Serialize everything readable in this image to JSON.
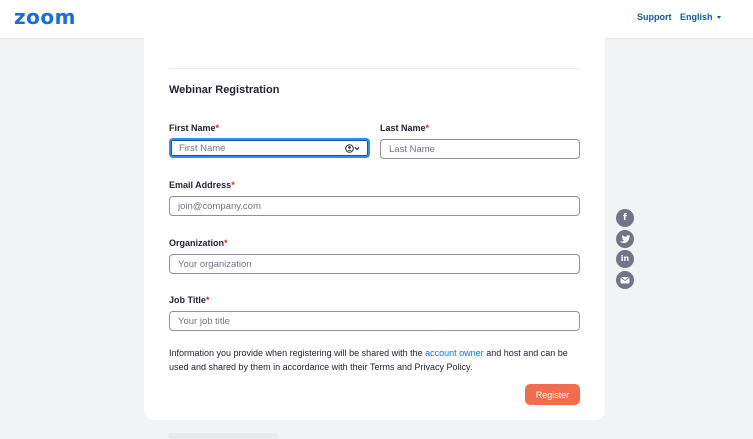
{
  "header": {
    "logo": "zoom",
    "support_label": "Support",
    "language_label": "English"
  },
  "form": {
    "title": "Webinar Registration",
    "first_name": {
      "label": "First Name",
      "required": "*",
      "placeholder": "First Name"
    },
    "last_name": {
      "label": "Last Name",
      "required": "*",
      "placeholder": "Last Name"
    },
    "email": {
      "label": "Email Address",
      "required": "*",
      "placeholder": "join@company.com"
    },
    "organization": {
      "label": "Organization",
      "required": "*",
      "placeholder": "Your organization"
    },
    "job_title": {
      "label": "Job Title",
      "required": "*",
      "placeholder": "Your job title"
    },
    "info_before": "Information you provide when registering will be shared with the ",
    "info_link": "account owner",
    "info_after": " and host and can be used and shared by them in accordance with their Terms and Privacy Policy.",
    "register_label": "Register"
  },
  "share_icons": [
    "facebook-icon",
    "twitter-icon",
    "linkedin-icon",
    "email-icon"
  ],
  "colors": {
    "brand": "#1a6de0",
    "register": "#f26d4f",
    "link": "#0e72ed",
    "required": "#e02828",
    "focus": "#2d8cff"
  }
}
